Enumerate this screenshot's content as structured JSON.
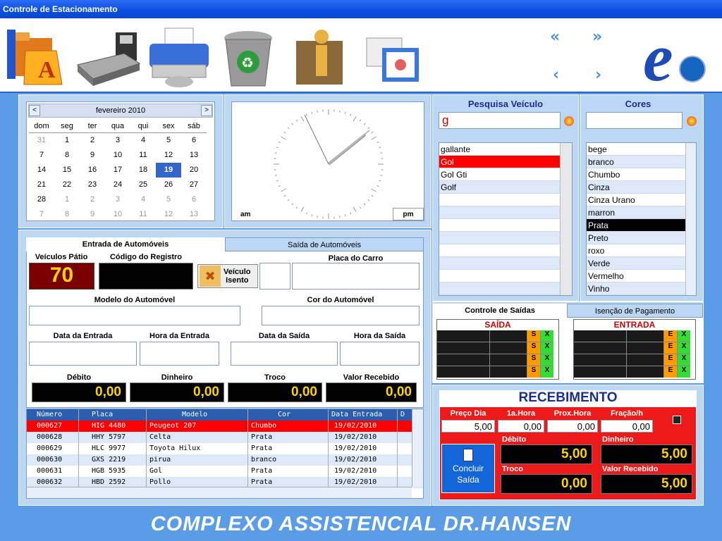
{
  "window": {
    "title": "Controle de Estacionamento"
  },
  "toolbar": {
    "icons": [
      "folder-icon",
      "scanner-icon",
      "printer-icon",
      "recycle-bin-icon",
      "user-info-icon",
      "print-preview-icon",
      "ie-logo-icon"
    ]
  },
  "calendar": {
    "month_label": "fevereiro 2010",
    "prev": "<",
    "next": ">",
    "day_names": [
      "dom",
      "seg",
      "ter",
      "qua",
      "qui",
      "sex",
      "sáb"
    ],
    "weeks": [
      [
        "31",
        "1",
        "2",
        "3",
        "4",
        "5",
        "6"
      ],
      [
        "7",
        "8",
        "9",
        "10",
        "11",
        "12",
        "13"
      ],
      [
        "14",
        "15",
        "16",
        "17",
        "18",
        "19",
        "20"
      ],
      [
        "21",
        "22",
        "23",
        "24",
        "25",
        "26",
        "27"
      ],
      [
        "28",
        "1",
        "2",
        "3",
        "4",
        "5",
        "6"
      ],
      [
        "7",
        "8",
        "9",
        "10",
        "11",
        "12",
        "13"
      ]
    ],
    "selected": "19"
  },
  "clock": {
    "am": "am",
    "pm": "pm"
  },
  "tabs": {
    "entrada": "Entrada de Automóveis",
    "saida": "Saída de Automóveis"
  },
  "entry": {
    "veiculos_patio_label": "Veículos Pátio",
    "veiculos_patio": "70",
    "codigo_label": "Código do Registro",
    "veiculo_isento": "Veículo\nIsento",
    "placa_label": "Placa do Carro",
    "modelo_label": "Modelo do Automóvel",
    "cor_label": "Cor do Automóvel",
    "data_entrada_label": "Data da Entrada",
    "hora_entrada_label": "Hora da Entrada",
    "data_saida_label": "Data da Saída",
    "hora_saida_label": "Hora da Saída",
    "debito_label": "Débito",
    "dinheiro_label": "Dinheiro",
    "troco_label": "Troco",
    "valor_recebido_label": "Valor Recebido",
    "debito": "0,00",
    "dinheiro": "0,00",
    "troco": "0,00",
    "valor_recebido": "0,00"
  },
  "table": {
    "headers": [
      "Número",
      "Placa",
      "Modelo",
      "Cor",
      "Data Entrada",
      "D"
    ],
    "rows": [
      [
        "000627",
        "HIG 4480",
        "Peugeot 207",
        "Chumbo",
        "19/02/2010"
      ],
      [
        "000628",
        "HHY 5797",
        "Celta",
        "Prata",
        "19/02/2010"
      ],
      [
        "000629",
        "HLC 9977",
        "Toyota Hilux",
        "Prata",
        "19/02/2010"
      ],
      [
        "000630",
        "GXS 2219",
        "pirua",
        "branco",
        "19/02/2010"
      ],
      [
        "000631",
        "HGB 5935",
        "Gol",
        "Prata",
        "19/02/2010"
      ],
      [
        "000632",
        "HBD 2592",
        "Pollo",
        "Prata",
        "19/02/2010"
      ]
    ]
  },
  "search": {
    "title": "Pesquisa Veículo",
    "value": "g",
    "results": [
      "gallante",
      "Gol",
      "Gol Gti",
      "Golf",
      "",
      "",
      "",
      "",
      "",
      "",
      "",
      ""
    ]
  },
  "colors": {
    "title": "Cores",
    "value": "",
    "items": [
      "bege",
      "branco",
      "Chumbo",
      "Cinza",
      "Cinza Urano",
      "marron",
      "Prata",
      "Preto",
      "roxo",
      "Verde",
      "Vermelho",
      "Vinho"
    ]
  },
  "controle": {
    "tab1": "Controle de Saídas",
    "tab2": "Isenção de Pagamento",
    "saida": "SAÍDA",
    "entrada": "ENTRADA",
    "s": "S",
    "x": "X",
    "e": "E"
  },
  "recebimento": {
    "title": "RECEBIMENTO",
    "preco_dia_label": "Preço Dia",
    "hora1_label": "1a.Hora",
    "prox_hora_label": "Prox.Hora",
    "fracao_label": "Fração/h",
    "preco_dia": "5,00",
    "hora1": "0,00",
    "prox_hora": "0,00",
    "fracao": "0,00",
    "debito_label": "Débito",
    "dinheiro_label": "Dinheiro",
    "troco_label": "Troco",
    "valor_recebido_label": "Valor Recebido",
    "debito": "5,00",
    "dinheiro": "5,00",
    "troco": "0,00",
    "valor_recebido": "5,00",
    "concluir": "Concluir\nSaída"
  },
  "footer": {
    "text": "COMPLEXO ASSISTENCIAL DR.HANSEN"
  },
  "accent": {
    "blue": "#5a9de6",
    "red": "#ff0000",
    "yellow": "#ffd400"
  }
}
